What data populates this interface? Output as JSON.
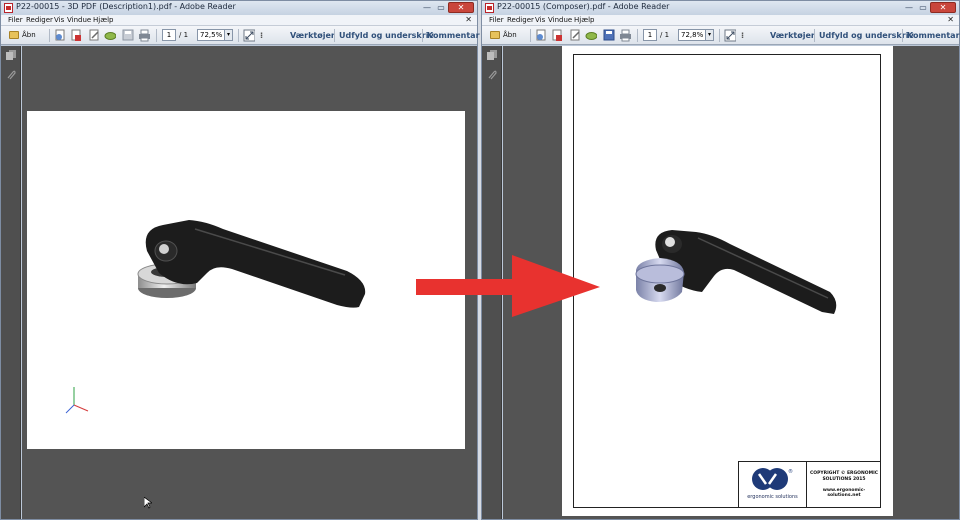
{
  "left_window": {
    "title": "P22-00015 - 3D PDF (Description1).pdf - Adobe Reader",
    "menu": [
      "Filer",
      "Rediger",
      "Vis",
      "Vindue",
      "Hjælp"
    ],
    "toolbar": {
      "open_label": "Åbn",
      "page_current": "1",
      "page_total": "/ 1",
      "zoom": "72,5%",
      "tools_label": "Værktøjer",
      "fill_sign_label": "Udfyld og underskriv",
      "comment_label": "Kommentar"
    },
    "icons": [
      "open-folder-icon",
      "create-pdf-icon",
      "pdf-export-icon",
      "edit-icon",
      "cloud-icon",
      "save-icon",
      "print-icon",
      "fit-page-icon",
      "more-icon"
    ]
  },
  "right_window": {
    "title": "P22-00015 (Composer).pdf - Adobe Reader",
    "menu": [
      "Filer",
      "Rediger",
      "Vis",
      "Vindue",
      "Hjælp"
    ],
    "toolbar": {
      "open_label": "Åbn",
      "page_current": "1",
      "page_total": "/ 1",
      "zoom": "72,8%",
      "tools_label": "Værktøjer",
      "fill_sign_label": "Udfyld og underskriv",
      "comment_label": "Kommentar"
    },
    "title_block": {
      "company": "ergonomic solutions",
      "copyright_line1": "COPYRIGHT © ERGONOMIC",
      "copyright_line2": "SOLUTIONS 2015",
      "url": "www.ergonomic-solutions.net"
    }
  },
  "colors": {
    "arrow": "#e8322f",
    "viewport_bg": "#545454",
    "toolbar_text": "#30507a"
  }
}
